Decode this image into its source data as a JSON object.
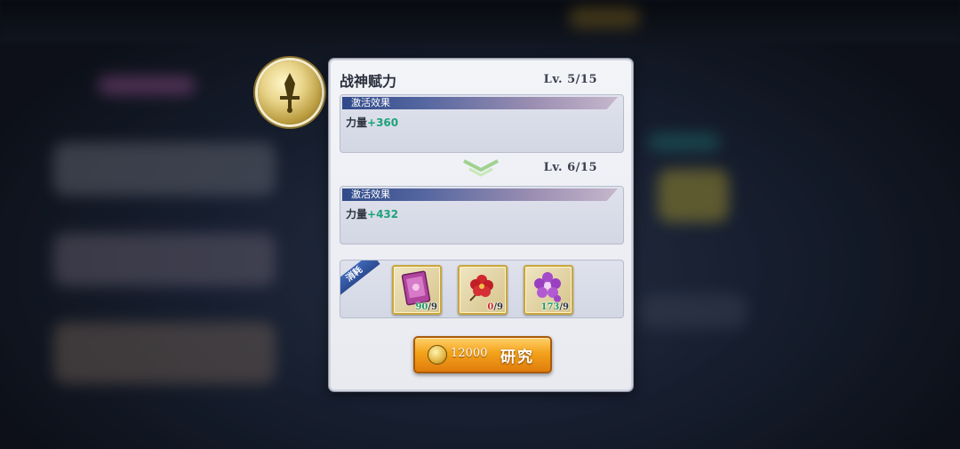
{
  "skill": {
    "icon": "sword-icon",
    "name": "战神赋力"
  },
  "current": {
    "level": "Lv.  5/15",
    "effect_header": "激活效果",
    "effect_stat": "力量",
    "effect_value": "+360"
  },
  "next": {
    "level": "Lv.  6/15",
    "effect_header": "激活效果",
    "effect_stat": "力量",
    "effect_value": "+432"
  },
  "consume": {
    "label": "消耗",
    "items": [
      {
        "icon": "book-icon",
        "have": "90",
        "need": "/9",
        "sufficient": true
      },
      {
        "icon": "red-flower-icon",
        "have": "0",
        "need": "/9",
        "sufficient": false
      },
      {
        "icon": "purple-flower-icon",
        "have": "173",
        "need": "/9",
        "sufficient": true
      }
    ]
  },
  "research_button": {
    "cost_icon": "gold-coin-icon",
    "cost": "12000",
    "label": "研究"
  },
  "colors": {
    "value_green": "#1fa27a",
    "insufficient_red": "#d02a2a",
    "button_orange": "#f3a21a"
  }
}
